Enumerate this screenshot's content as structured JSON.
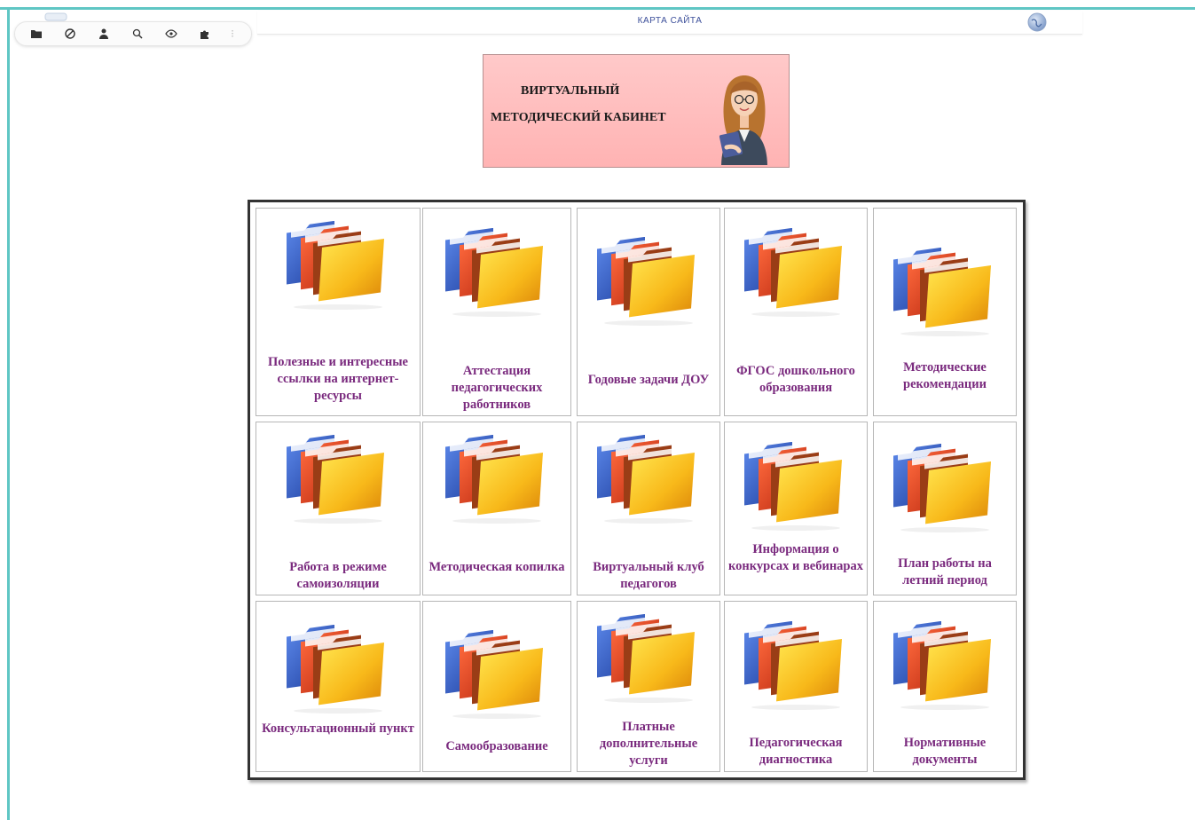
{
  "topbar": {
    "sitemap_label": "КАРТА САЙТА"
  },
  "toolbar": {
    "icons": [
      "folder-icon",
      "disabled-icon",
      "user-icon",
      "search-icon",
      "eye-icon",
      "puzzle-icon"
    ]
  },
  "banner": {
    "line1": "ВИРТУАЛЬНЫЙ",
    "line2": "МЕТОДИЧЕСКИЙ КАБИНЕТ"
  },
  "colors": {
    "frame": "#5fc6c4",
    "banner_bg": "#ffb3b3",
    "label": "#7a2a7e",
    "link": "#3c4f9a"
  },
  "sections": [
    {
      "label": "Полезные и интересные ссылки на интернет-ресурсы"
    },
    {
      "label": "Аттестация педагогических работников"
    },
    {
      "label": "Годовые задачи ДОУ"
    },
    {
      "label": "ФГОС дошкольного образования"
    },
    {
      "label": "Методические рекомендации"
    },
    {
      "label": "Работа в режиме самоизоляции"
    },
    {
      "label": "Методическая копилка"
    },
    {
      "label": "Виртуальный клуб педагогов"
    },
    {
      "label": "Информация о конкурсах и вебинарах"
    },
    {
      "label": "План работы на летний период"
    },
    {
      "label": "Консультационный пункт"
    },
    {
      "label": "Самообразование"
    },
    {
      "label": "Платные дополнительные услуги"
    },
    {
      "label": "Педагогическая диагностика"
    },
    {
      "label": "Нормативные документы"
    }
  ]
}
